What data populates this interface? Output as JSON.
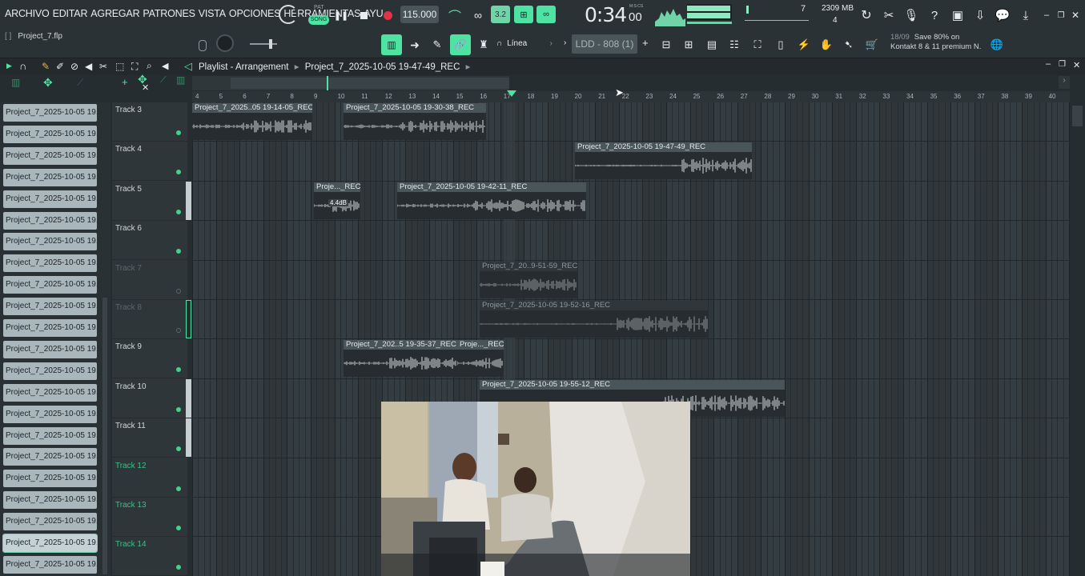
{
  "menu": [
    "ARCHIVO",
    "EDITAR",
    "AGREGAR",
    "PATRONES",
    "VISTA",
    "OPCIONES",
    "HERRAMIENTAS",
    "AYU"
  ],
  "transport": {
    "pat": "PAT",
    "song": "SONG",
    "tempo": "115.000",
    "time": "0:34",
    "time_small": "00",
    "time_unit": "M:S:CS"
  },
  "monitor": {
    "memory": "2309 MB",
    "voices": "7",
    "cpu": "4"
  },
  "project_file": "Project_7.flp",
  "snap_mode": "Línea",
  "channel_name": "LDD - 808 (1)",
  "news": {
    "date": "18/09",
    "line1": "Save 80% on",
    "line2": "Kontakt 8 & 11 premium N."
  },
  "playlist": {
    "label": "Playlist - Arrangement",
    "arrangement": "Project_7_2025-10-05 19-47-49_REC"
  },
  "ruler": [
    "4",
    "5",
    "6",
    "7",
    "8",
    "9",
    "10",
    "11",
    "12",
    "13",
    "14",
    "15",
    "16",
    "17",
    "18",
    "19",
    "20",
    "21",
    "22",
    "23",
    "24",
    "25",
    "26",
    "27",
    "28",
    "29",
    "30",
    "31",
    "32",
    "33",
    "34",
    "35",
    "36",
    "37",
    "38",
    "39",
    "40"
  ],
  "picker_items": [
    "Project_7_2025-10-05 19...",
    "Project_7_2025-10-05 19...",
    "Project_7_2025-10-05 19...",
    "Project_7_2025-10-05 19...",
    "Project_7_2025-10-05 19...",
    "Project_7_2025-10-05 19...",
    "Project_7_2025-10-05 19...",
    "Project_7_2025-10-05 19...",
    "Project_7_2025-10-05 19...",
    "Project_7_2025-10-05 19...",
    "Project_7_2025-10-05 19...",
    "Project_7_2025-10-05 19...",
    "Project_7_2025-10-05 19...",
    "Project_7_2025-10-05 19...",
    "Project_7_2025-10-05 19...",
    "Project_7_2025-10-05 19...",
    "Project_7_2025-10-05 19...",
    "Project_7_2025-10-05 19...",
    "Project_7_2025-10-05 19...",
    "Project_7_2025-10-05 19...",
    "Project_7_2025-10-05 19...",
    "Project_7_2025-10-05 19..."
  ],
  "tracks": [
    {
      "name": "Track 3",
      "state": "normal"
    },
    {
      "name": "Track 4",
      "state": "normal"
    },
    {
      "name": "Track 5",
      "state": "normal"
    },
    {
      "name": "Track 6",
      "state": "normal"
    },
    {
      "name": "Track 7",
      "state": "muted"
    },
    {
      "name": "Track 8",
      "state": "muted"
    },
    {
      "name": "Track 9",
      "state": "normal"
    },
    {
      "name": "Track 10",
      "state": "normal"
    },
    {
      "name": "Track 11",
      "state": "normal"
    },
    {
      "name": "Track 12",
      "state": "green"
    },
    {
      "name": "Track 13",
      "state": "green"
    },
    {
      "name": "Track 14",
      "state": "green"
    }
  ],
  "clips": [
    {
      "track": 0,
      "label": "Project_7_2025..05 19-14-05_REC"
    },
    {
      "track": 0,
      "label": "Project_7_2025-10-05 19-30-38_REC"
    },
    {
      "track": 1,
      "label": "Project_7_2025-10-05 19-47-49_REC"
    },
    {
      "track": 2,
      "label": "Proje..._REC"
    },
    {
      "track": 2,
      "label": "Project_7_2025-10-05 19-42-11_REC"
    },
    {
      "track": 4,
      "label": "Project_7_20..9-51-59_REC"
    },
    {
      "track": 5,
      "label": "Project_7_2025-10-05 19-52-16_REC"
    },
    {
      "track": 6,
      "label": "Project_7_202..5 19-35-37_REC"
    },
    {
      "track": 6,
      "label": "Proje..._REC"
    },
    {
      "track": 7,
      "label": "Project_7_2025-10-05 19-55-12_REC"
    }
  ],
  "clip_gain": "4.4dB",
  "colors": {
    "accent": "#4fe3a3",
    "clip_header": "#4a555a",
    "picker_item": "#a9b6bc"
  }
}
